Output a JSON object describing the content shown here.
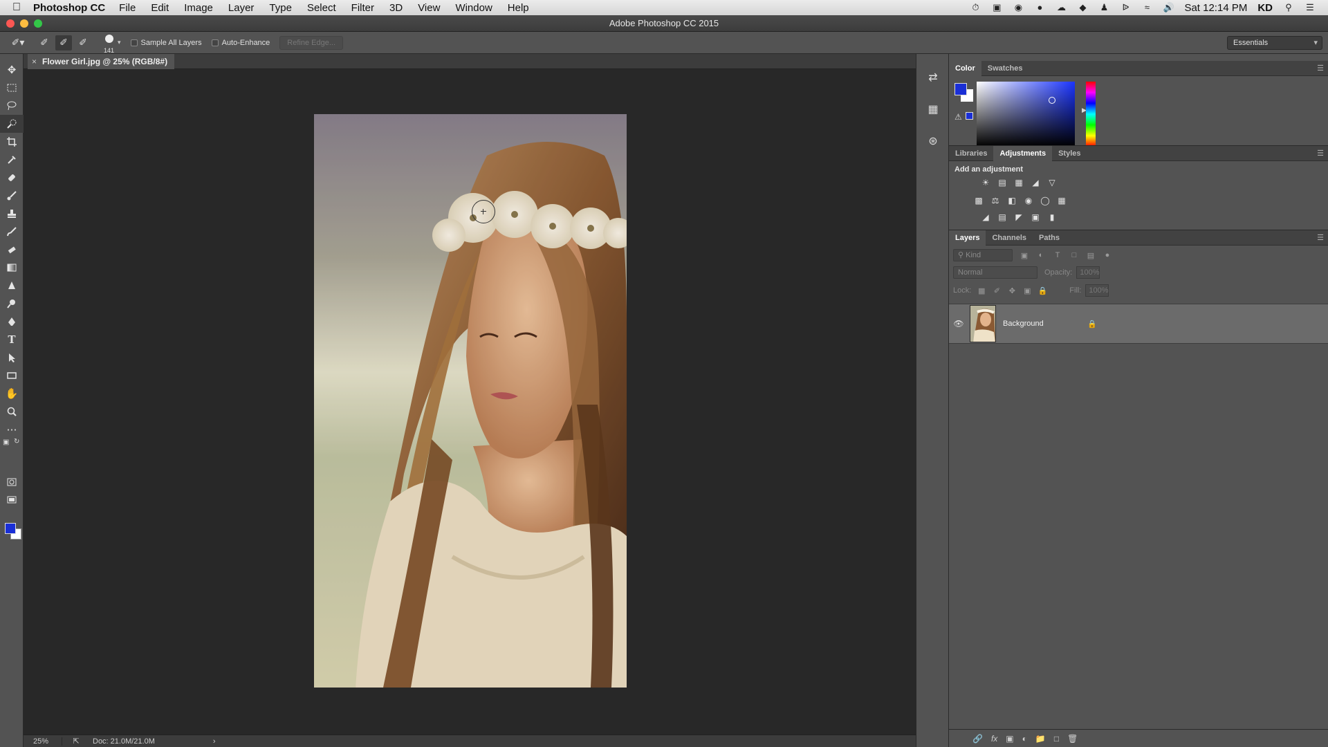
{
  "menubar": {
    "app_name": "Photoshop CC",
    "items": [
      "File",
      "Edit",
      "Image",
      "Layer",
      "Type",
      "Select",
      "Filter",
      "3D",
      "View",
      "Window",
      "Help"
    ],
    "clock": "Sat 12:14 PM",
    "user": "KD"
  },
  "window": {
    "title": "Adobe Photoshop CC 2015"
  },
  "options": {
    "brush_size": "141",
    "sample_all_layers": "Sample All Layers",
    "auto_enhance": "Auto-Enhance",
    "refine_edge": "Refine Edge...",
    "workspace": "Essentials"
  },
  "document": {
    "tab_title": "Flower Girl.jpg @ 25% (RGB/8#)",
    "zoom": "25%",
    "doc_size": "Doc: 21.0M/21.0M"
  },
  "colors": {
    "foreground": "#1a2fd6",
    "background": "#ffffff"
  },
  "color_panel": {
    "tabs": [
      "Color",
      "Swatches"
    ]
  },
  "adjustments_panel": {
    "tabs": [
      "Libraries",
      "Adjustments",
      "Styles"
    ],
    "heading": "Add an adjustment"
  },
  "layers_panel": {
    "tabs": [
      "Layers",
      "Channels",
      "Paths"
    ],
    "filter_placeholder": "Kind",
    "blend_mode": "Normal",
    "opacity_label": "Opacity:",
    "opacity_value": "100%",
    "lock_label": "Lock:",
    "fill_label": "Fill:",
    "fill_value": "100%",
    "layers": [
      {
        "name": "Background",
        "locked": true,
        "visible": true
      }
    ]
  }
}
